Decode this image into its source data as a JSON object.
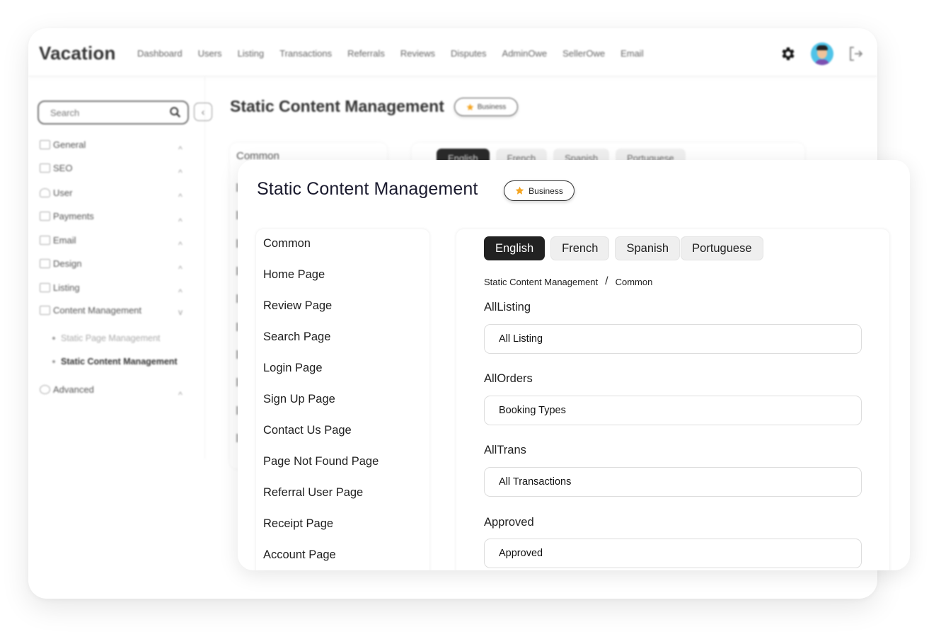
{
  "app": {
    "brand": "Vacation",
    "nav": [
      "Dashboard",
      "Users",
      "Listing",
      "Transactions",
      "Referrals",
      "Reviews",
      "Disputes",
      "AdminOwe",
      "SellerOwe",
      "Email"
    ],
    "icons": {
      "settings": "gear-icon",
      "avatar": "user-avatar",
      "logout": "logout-icon"
    }
  },
  "sidebar": {
    "search_placeholder": "Search",
    "collapse_glyph": "‹",
    "items": [
      {
        "label": "General",
        "icon": "monitor-icon",
        "chevron": "^"
      },
      {
        "label": "SEO",
        "icon": "seo-icon",
        "chevron": "^"
      },
      {
        "label": "User",
        "icon": "user-icon",
        "chevron": "^"
      },
      {
        "label": "Payments",
        "icon": "wallet-icon",
        "chevron": "^"
      },
      {
        "label": "Email",
        "icon": "email-icon",
        "chevron": "^"
      },
      {
        "label": "Design",
        "icon": "design-icon",
        "chevron": "^"
      },
      {
        "label": "Listing",
        "icon": "listing-icon",
        "chevron": "^"
      },
      {
        "label": "Content Management",
        "icon": "content-icon",
        "chevron": "v"
      },
      {
        "label": "Advanced",
        "icon": "advanced-icon",
        "chevron": "^"
      }
    ],
    "sub_items": [
      {
        "label": "Static Page Management",
        "active": false
      },
      {
        "label": "Static Content Management",
        "active": true
      }
    ]
  },
  "background_page": {
    "title": "Static Content Management",
    "badge": "Business",
    "first_list_item": "Common",
    "tabs": [
      "English",
      "French",
      "Spanish",
      "Portuguese"
    ]
  },
  "page": {
    "title": "Static Content Management",
    "badge": "Business",
    "pages": [
      "Common",
      "Home Page",
      "Review Page",
      "Search Page",
      "Login Page",
      "Sign Up Page",
      "Contact Us Page",
      "Page Not Found Page",
      "Referral User Page",
      "Receipt Page",
      "Account Page"
    ],
    "languages": [
      "English",
      "French",
      "Spanish",
      "Portuguese"
    ],
    "active_language": "English",
    "breadcrumb": [
      "Static Content Management",
      "Common"
    ],
    "breadcrumb_separator": "/",
    "fields": [
      {
        "label": "AllListing",
        "value": "All Listing"
      },
      {
        "label": "AllOrders",
        "value": "Booking Types"
      },
      {
        "label": "AllTrans",
        "value": "All Transactions"
      },
      {
        "label": "Approved",
        "value": "Approved"
      }
    ]
  },
  "colors": {
    "accent_dark": "#222222",
    "star": "#f5a623",
    "avatar_bg": "#4fc3e8"
  }
}
